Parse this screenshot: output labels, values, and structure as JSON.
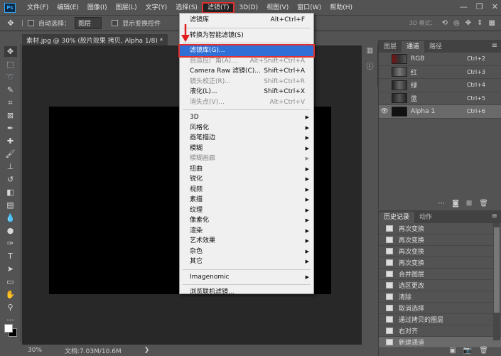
{
  "menubar": {
    "logo": "Ps",
    "items": [
      "文件(F)",
      "编辑(E)",
      "图像(I)",
      "图层(L)",
      "文字(Y)",
      "选择(S)",
      "滤镜(T)",
      "3D(D)",
      "视图(V)",
      "窗口(W)",
      "帮助(H)"
    ],
    "active_index": 6,
    "window_controls": [
      "—",
      "❐",
      "✕"
    ]
  },
  "optionsbar": {
    "auto_select_label": "自动选择：",
    "auto_select_value": "图层",
    "show_transform_label": "显示变换控件",
    "mode_3d": "3D 模式："
  },
  "document": {
    "tab_title": "素材.jpg @ 30% (胶片效果 拷贝, Alpha 1/8) *",
    "zoom": "30%",
    "doc_info": "文档:7.03M/10.6M"
  },
  "filter_menu": {
    "items": [
      {
        "label": "滤镜库",
        "shortcut": "Alt+Ctrl+F",
        "state": "normal",
        "submenu": false
      },
      {
        "sep": true
      },
      {
        "label": "转换为智能滤镜(S)",
        "shortcut": "",
        "state": "normal",
        "submenu": false
      },
      {
        "sep": true
      },
      {
        "label": "滤镜库(G)...",
        "shortcut": "",
        "state": "highlight",
        "submenu": false
      },
      {
        "label": "自适应广角(A)...",
        "shortcut": "Alt+Shift+Ctrl+A",
        "state": "disabled",
        "submenu": false
      },
      {
        "label": "Camera Raw 滤镜(C)...",
        "shortcut": "Shift+Ctrl+A",
        "state": "normal",
        "submenu": false
      },
      {
        "label": "镜头校正(R)...",
        "shortcut": "Shift+Ctrl+R",
        "state": "disabled",
        "submenu": false
      },
      {
        "label": "液化(L)...",
        "shortcut": "Shift+Ctrl+X",
        "state": "normal",
        "submenu": false
      },
      {
        "label": "消失点(V)...",
        "shortcut": "Alt+Ctrl+V",
        "state": "disabled",
        "submenu": false
      },
      {
        "sep": true
      },
      {
        "label": "3D",
        "shortcut": "",
        "state": "normal",
        "submenu": true
      },
      {
        "label": "风格化",
        "shortcut": "",
        "state": "normal",
        "submenu": true
      },
      {
        "label": "画笔描边",
        "shortcut": "",
        "state": "normal",
        "submenu": true
      },
      {
        "label": "模糊",
        "shortcut": "",
        "state": "normal",
        "submenu": true
      },
      {
        "label": "模糊画廊",
        "shortcut": "",
        "state": "disabled",
        "submenu": true
      },
      {
        "label": "扭曲",
        "shortcut": "",
        "state": "normal",
        "submenu": true
      },
      {
        "label": "锐化",
        "shortcut": "",
        "state": "normal",
        "submenu": true
      },
      {
        "label": "视频",
        "shortcut": "",
        "state": "normal",
        "submenu": true
      },
      {
        "label": "素描",
        "shortcut": "",
        "state": "normal",
        "submenu": true
      },
      {
        "label": "纹理",
        "shortcut": "",
        "state": "normal",
        "submenu": true
      },
      {
        "label": "像素化",
        "shortcut": "",
        "state": "normal",
        "submenu": true
      },
      {
        "label": "渲染",
        "shortcut": "",
        "state": "normal",
        "submenu": true
      },
      {
        "label": "艺术效果",
        "shortcut": "",
        "state": "normal",
        "submenu": true
      },
      {
        "label": "杂色",
        "shortcut": "",
        "state": "normal",
        "submenu": true
      },
      {
        "label": "其它",
        "shortcut": "",
        "state": "normal",
        "submenu": true
      },
      {
        "sep": true
      },
      {
        "label": "Imagenomic",
        "shortcut": "",
        "state": "normal",
        "submenu": true
      },
      {
        "sep": true
      },
      {
        "label": "浏览联机滤镜...",
        "shortcut": "",
        "state": "normal",
        "submenu": false
      }
    ]
  },
  "channels_panel": {
    "tabs": [
      "图层",
      "通道",
      "路径"
    ],
    "active_tab": 1,
    "rows": [
      {
        "name": "RGB",
        "shortcut": "Ctrl+2",
        "thumb": "rgb",
        "visible": false,
        "selected": false
      },
      {
        "name": "红",
        "shortcut": "Ctrl+3",
        "thumb": "r",
        "visible": false,
        "selected": false
      },
      {
        "name": "绿",
        "shortcut": "Ctrl+4",
        "thumb": "g",
        "visible": false,
        "selected": false
      },
      {
        "name": "蓝",
        "shortcut": "Ctrl+5",
        "thumb": "b",
        "visible": false,
        "selected": false
      },
      {
        "name": "Alpha 1",
        "shortcut": "Ctrl+6",
        "thumb": "a",
        "visible": true,
        "selected": true
      }
    ]
  },
  "history_panel": {
    "tabs": [
      "历史记录",
      "动作"
    ],
    "active_tab": 0,
    "items": [
      "再次变换",
      "再次变换",
      "再次变换",
      "再次变换",
      "合并图层",
      "选区更改",
      "清除",
      "取消选择",
      "通过拷贝的图层",
      "右对齐",
      "新建通道"
    ],
    "selected_index": 10
  }
}
